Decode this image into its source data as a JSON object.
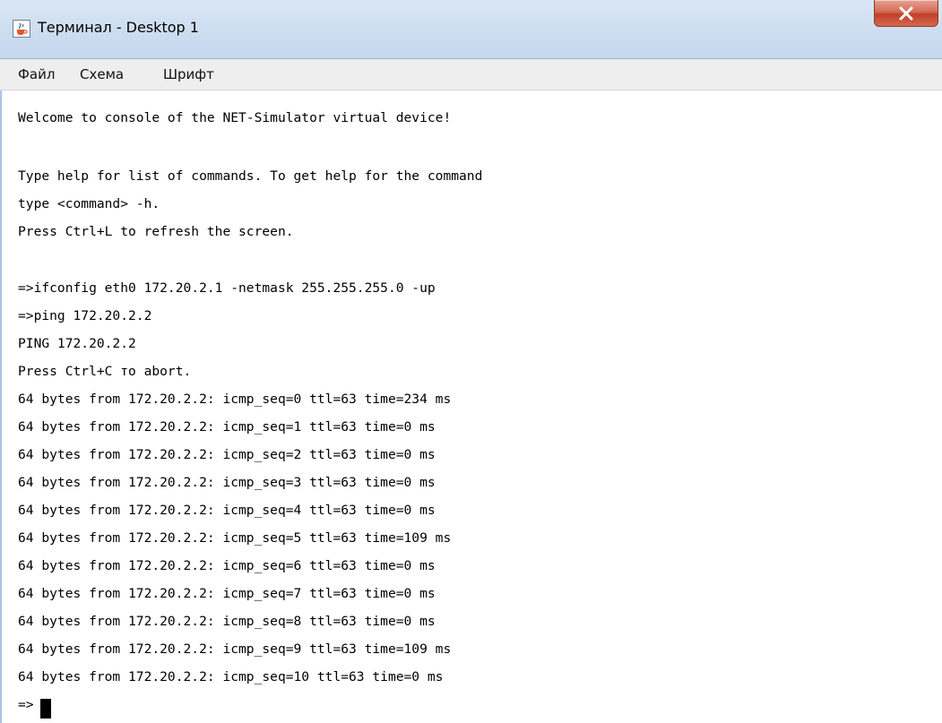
{
  "window": {
    "title": "Терминал - Desktop 1",
    "icon": "java-cup-icon",
    "close_label": "X",
    "accent": "#c0402a"
  },
  "menu": {
    "file": "Файл",
    "scheme": "Схема",
    "font": "Шрифт"
  },
  "console": {
    "lines": [
      "Welcome to console of the NET-Simulator virtual device!",
      "",
      "Type help for list of commands. To get help for the command",
      "type <command> -h.",
      "Press Ctrl+L to refresh the screen.",
      "",
      "=>ifconfig eth0 172.20.2.1 -netmask 255.255.255.0 -up",
      "=>ping 172.20.2.2",
      "PING 172.20.2.2",
      "Press Ctrl+C то abort.",
      "64 bytes from 172.20.2.2: icmp_seq=0 ttl=63 time=234 ms",
      "64 bytes from 172.20.2.2: icmp_seq=1 ttl=63 time=0 ms",
      "64 bytes from 172.20.2.2: icmp_seq=2 ttl=63 time=0 ms",
      "64 bytes from 172.20.2.2: icmp_seq=3 ttl=63 time=0 ms",
      "64 bytes from 172.20.2.2: icmp_seq=4 ttl=63 time=0 ms",
      "64 bytes from 172.20.2.2: icmp_seq=5 ttl=63 time=109 ms",
      "64 bytes from 172.20.2.2: icmp_seq=6 ttl=63 time=0 ms",
      "64 bytes from 172.20.2.2: icmp_seq=7 ttl=63 time=0 ms",
      "64 bytes from 172.20.2.2: icmp_seq=8 ttl=63 time=0 ms",
      "64 bytes from 172.20.2.2: icmp_seq=9 ttl=63 time=109 ms",
      "64 bytes from 172.20.2.2: icmp_seq=10 ttl=63 time=0 ms",
      "=>"
    ]
  }
}
